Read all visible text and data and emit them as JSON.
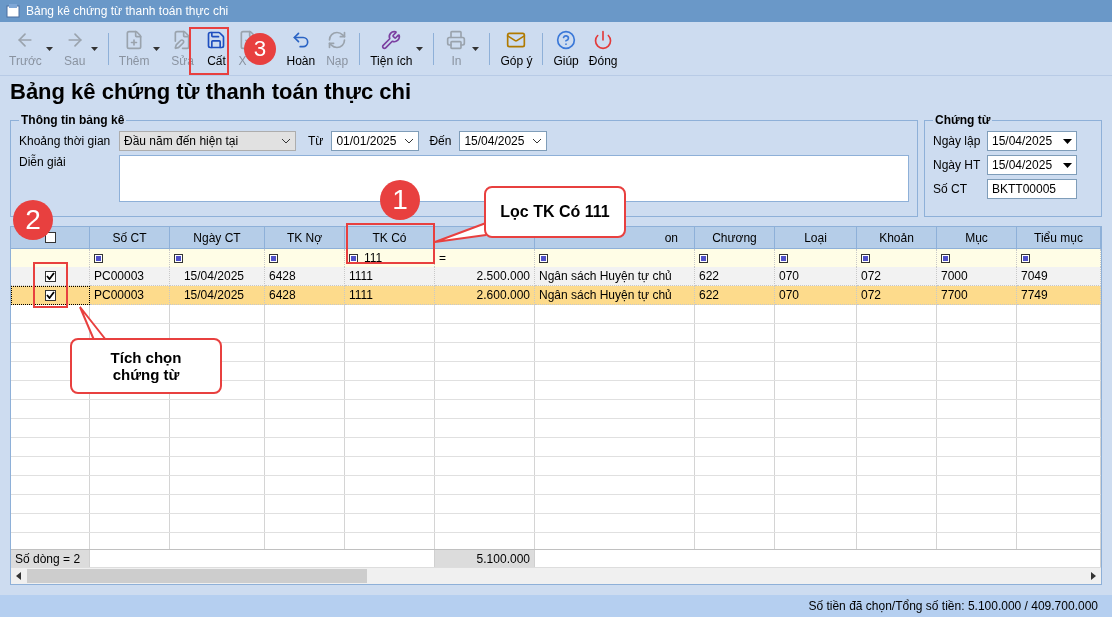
{
  "window": {
    "title": "Bảng kê chứng từ thanh toán thực chi"
  },
  "toolbar": {
    "groups": [
      [
        {
          "label": "Trước",
          "disabled": true,
          "dropdown": true
        },
        {
          "label": "Sau",
          "disabled": true,
          "dropdown": true
        }
      ],
      [
        {
          "label": "Thêm",
          "disabled": true,
          "dropdown": true
        },
        {
          "label": "Sửa",
          "disabled": true,
          "dropdown": false
        },
        {
          "label": "Cất",
          "disabled": false,
          "dropdown": false
        },
        {
          "label": "X",
          "disabled": true,
          "dropdown": false
        },
        {
          "label": "Hoàn",
          "disabled": false,
          "dropdown": false
        },
        {
          "label": "Nạp",
          "disabled": true,
          "dropdown": false
        }
      ],
      [
        {
          "label": "Tiện ích",
          "disabled": false,
          "dropdown": true
        }
      ],
      [
        {
          "label": "In",
          "disabled": true,
          "dropdown": true
        }
      ],
      [
        {
          "label": "Góp ý",
          "disabled": false,
          "dropdown": false
        }
      ],
      [
        {
          "label": "Giúp",
          "disabled": false,
          "dropdown": false
        },
        {
          "label": "Đóng",
          "disabled": false,
          "dropdown": false
        }
      ]
    ]
  },
  "heading": "Bảng kê chứng từ thanh toán thực chi",
  "info_group": {
    "title": "Thông tin bảng kê",
    "period_label": "Khoảng thời gian",
    "period_value": "Đầu năm đến hiện tại",
    "from_label": "Từ",
    "from_value": "01/01/2025",
    "to_label": "Đến",
    "to_value": "15/04/2025",
    "description_label": "Diễn giải"
  },
  "voucher_group": {
    "title": "Chứng từ",
    "fields": [
      {
        "label": "Ngày lập",
        "value": "15/04/2025",
        "kind": "dropdown"
      },
      {
        "label": "Ngày HT",
        "value": "15/04/2025",
        "kind": "dropdown"
      },
      {
        "label": "Số CT",
        "value": "BKTT00005",
        "kind": "text"
      }
    ]
  },
  "table": {
    "checkbox_column": {
      "header_checked": false
    },
    "columns": [
      {
        "header": "Số CT",
        "filter": {
          "kind": "icon"
        }
      },
      {
        "header": "Ngày CT",
        "filter": {
          "kind": "icon"
        }
      },
      {
        "header": "TK Nợ",
        "filter": {
          "kind": "icon"
        }
      },
      {
        "header": "TK Có",
        "filter": {
          "kind": "icon",
          "value": "111"
        }
      },
      {
        "filter": {
          "kind": "operator",
          "value": "="
        }
      },
      {
        "header": "on",
        "filter": {
          "kind": "icon"
        }
      },
      {
        "header": "Chương",
        "filter": {
          "kind": "icon"
        }
      },
      {
        "header": "Loại",
        "filter": {
          "kind": "icon"
        }
      },
      {
        "header": "Khoản",
        "filter": {
          "kind": "icon"
        }
      },
      {
        "header": "Mục",
        "filter": {
          "kind": "icon"
        }
      },
      {
        "header": "Tiểu mục",
        "filter": {
          "kind": "icon"
        }
      }
    ],
    "rows": [
      {
        "checked": true,
        "selected": false,
        "cells": [
          "PC00003",
          "15/04/2025",
          "6428",
          "1111",
          "2.500.000",
          "Ngân sách Huyện tự chủ",
          "622",
          "070",
          "072",
          "7000",
          "7049"
        ]
      },
      {
        "checked": true,
        "selected": true,
        "cells": [
          "PC00003",
          "15/04/2025",
          "6428",
          "1111",
          "2.600.000",
          "Ngân sách Huyện tự chủ",
          "622",
          "070",
          "072",
          "7700",
          "7749"
        ]
      }
    ],
    "footer": {
      "row_count": "Số dòng = 2",
      "total": "5.100.000"
    }
  },
  "status_bar": "Số tiền đã chọn/Tổng số tiền: 5.100.000 / 409.700.000",
  "annotations": {
    "markers": [
      "1",
      "2",
      "3"
    ],
    "callouts": [
      "Lọc TK Có 111",
      "Tích chọn chứng từ"
    ]
  }
}
